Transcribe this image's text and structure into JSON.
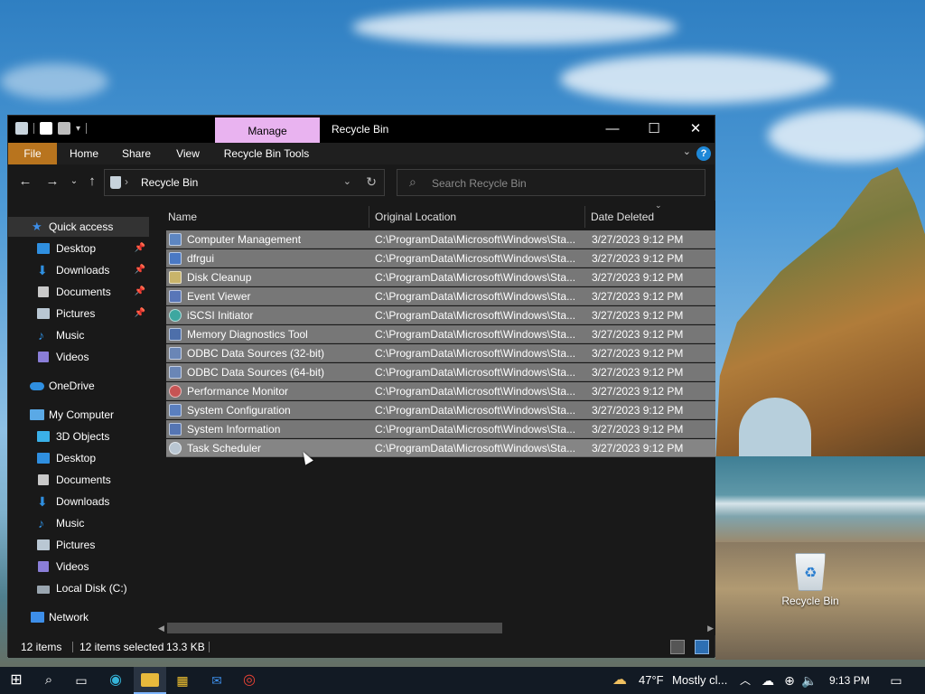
{
  "window": {
    "title": "Recycle Bin",
    "manage_label": "Manage",
    "minimize_glyph": "—",
    "maximize_glyph": "☐",
    "close_glyph": "✕"
  },
  "ribbon": {
    "tabs": [
      "File",
      "Home",
      "Share",
      "View",
      "Recycle Bin Tools"
    ],
    "help": "?"
  },
  "address": {
    "crumb": "Recycle Bin",
    "chevron": "›"
  },
  "search": {
    "placeholder": "Search Recycle Bin"
  },
  "sidebar": {
    "items": [
      {
        "label": "Quick access",
        "icon": "star-icon",
        "color": "#3d8ee8"
      },
      {
        "label": "Desktop",
        "icon": "desktop-icon",
        "color": "#2f8fe0",
        "pin": true
      },
      {
        "label": "Downloads",
        "icon": "download-icon",
        "color": "#2f8fe0",
        "pin": true
      },
      {
        "label": "Documents",
        "icon": "documents-icon",
        "color": "#c9c9c9",
        "pin": true
      },
      {
        "label": "Pictures",
        "icon": "pictures-icon",
        "color": "#b9c7d3",
        "pin": true
      },
      {
        "label": "Music",
        "icon": "music-icon",
        "color": "#2f8fe0"
      },
      {
        "label": "Videos",
        "icon": "videos-icon",
        "color": "#8a7ed8"
      },
      {
        "label": "OneDrive",
        "icon": "cloud-icon",
        "color": "#2f8fe0"
      },
      {
        "label": "My Computer",
        "icon": "computer-icon",
        "color": "#5aa9e6"
      },
      {
        "label": "3D Objects",
        "icon": "cube-icon",
        "color": "#3ab0e8"
      },
      {
        "label": "Desktop",
        "icon": "desktop-icon",
        "color": "#2f8fe0"
      },
      {
        "label": "Documents",
        "icon": "documents-icon",
        "color": "#c9c9c9"
      },
      {
        "label": "Downloads",
        "icon": "download-icon",
        "color": "#2f8fe0"
      },
      {
        "label": "Music",
        "icon": "music-icon",
        "color": "#2f8fe0"
      },
      {
        "label": "Pictures",
        "icon": "pictures-icon",
        "color": "#b9c7d3"
      },
      {
        "label": "Videos",
        "icon": "videos-icon",
        "color": "#8a7ed8"
      },
      {
        "label": "Local Disk (C:)",
        "icon": "disk-icon",
        "color": "#9aa6b0"
      },
      {
        "label": "Network",
        "icon": "network-icon",
        "color": "#3d8ee8"
      }
    ]
  },
  "columns": {
    "name": "Name",
    "location": "Original Location",
    "date": "Date Deleted"
  },
  "files": [
    {
      "name": "Computer Management",
      "location": "C:\\ProgramData\\Microsoft\\Windows\\Sta...",
      "date": "3/27/2023 9:12 PM",
      "icon": "computer-management-icon"
    },
    {
      "name": "dfrgui",
      "location": "C:\\ProgramData\\Microsoft\\Windows\\Sta...",
      "date": "3/27/2023 9:12 PM",
      "icon": "defrag-icon"
    },
    {
      "name": "Disk Cleanup",
      "location": "C:\\ProgramData\\Microsoft\\Windows\\Sta...",
      "date": "3/27/2023 9:12 PM",
      "icon": "disk-cleanup-icon"
    },
    {
      "name": "Event Viewer",
      "location": "C:\\ProgramData\\Microsoft\\Windows\\Sta...",
      "date": "3/27/2023 9:12 PM",
      "icon": "event-viewer-icon"
    },
    {
      "name": "iSCSI Initiator",
      "location": "C:\\ProgramData\\Microsoft\\Windows\\Sta...",
      "date": "3/27/2023 9:12 PM",
      "icon": "iscsi-icon"
    },
    {
      "name": "Memory Diagnostics Tool",
      "location": "C:\\ProgramData\\Microsoft\\Windows\\Sta...",
      "date": "3/27/2023 9:12 PM",
      "icon": "memory-diagnostics-icon"
    },
    {
      "name": "ODBC Data Sources (32-bit)",
      "location": "C:\\ProgramData\\Microsoft\\Windows\\Sta...",
      "date": "3/27/2023 9:12 PM",
      "icon": "odbc-icon"
    },
    {
      "name": "ODBC Data Sources (64-bit)",
      "location": "C:\\ProgramData\\Microsoft\\Windows\\Sta...",
      "date": "3/27/2023 9:12 PM",
      "icon": "odbc-icon"
    },
    {
      "name": "Performance Monitor",
      "location": "C:\\ProgramData\\Microsoft\\Windows\\Sta...",
      "date": "3/27/2023 9:12 PM",
      "icon": "performance-monitor-icon"
    },
    {
      "name": "System Configuration",
      "location": "C:\\ProgramData\\Microsoft\\Windows\\Sta...",
      "date": "3/27/2023 9:12 PM",
      "icon": "system-configuration-icon"
    },
    {
      "name": "System Information",
      "location": "C:\\ProgramData\\Microsoft\\Windows\\Sta...",
      "date": "3/27/2023 9:12 PM",
      "icon": "system-information-icon"
    },
    {
      "name": "Task Scheduler",
      "location": "C:\\ProgramData\\Microsoft\\Windows\\Sta...",
      "date": "3/27/2023 9:12 PM",
      "icon": "task-scheduler-icon"
    }
  ],
  "status": {
    "count": "12 items",
    "selected": "12 items selected",
    "size": "13.3 KB"
  },
  "desktop": {
    "recycle_bin_label": "Recycle Bin"
  },
  "taskbar": {
    "weather_temp": "47°F",
    "weather_desc": "Mostly cl...",
    "time": "9:13 PM"
  },
  "colors": {
    "selection": "#777777",
    "manage_tab": "#e9b3f0",
    "file_tab": "#b8741e",
    "window_bg": "#191919"
  }
}
